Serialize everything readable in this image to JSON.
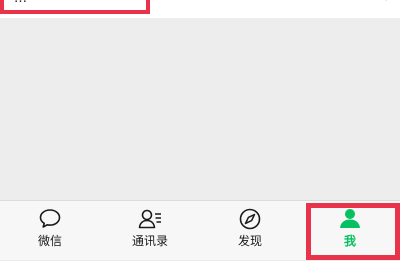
{
  "top_text": "…",
  "tabs": [
    {
      "label": "微信",
      "icon": "chat-bubble-icon"
    },
    {
      "label": "通讯录",
      "icon": "contacts-icon"
    },
    {
      "label": "发现",
      "icon": "compass-icon"
    },
    {
      "label": "我",
      "icon": "person-icon"
    }
  ],
  "active_tab": 3,
  "colors": {
    "accent": "#07c160",
    "highlight": "#e8334a",
    "background": "#ededed"
  }
}
